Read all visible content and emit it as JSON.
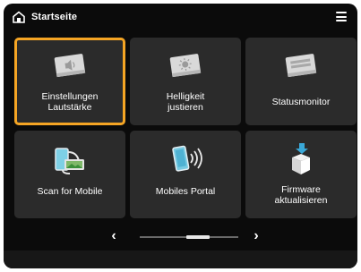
{
  "header": {
    "title": "Startseite"
  },
  "tiles": [
    {
      "label": "Einstellungen\nLautstärke",
      "icon": "speaker-card-icon",
      "selected": true
    },
    {
      "label": "Helligkeit\njustieren",
      "icon": "brightness-card-icon",
      "selected": false
    },
    {
      "label": "Statusmonitor",
      "icon": "status-monitor-icon",
      "selected": false
    },
    {
      "label": "Scan for Mobile",
      "icon": "scan-mobile-icon",
      "selected": false
    },
    {
      "label": "Mobiles Portal",
      "icon": "mobile-portal-icon",
      "selected": false
    },
    {
      "label": "Firmware\naktualisieren",
      "icon": "firmware-update-icon",
      "selected": false
    }
  ],
  "pager": {
    "prev": "‹",
    "next": "›"
  },
  "colors": {
    "background": "#0b0b0b",
    "tile": "#2b2b2b",
    "selection": "#f5a524"
  }
}
